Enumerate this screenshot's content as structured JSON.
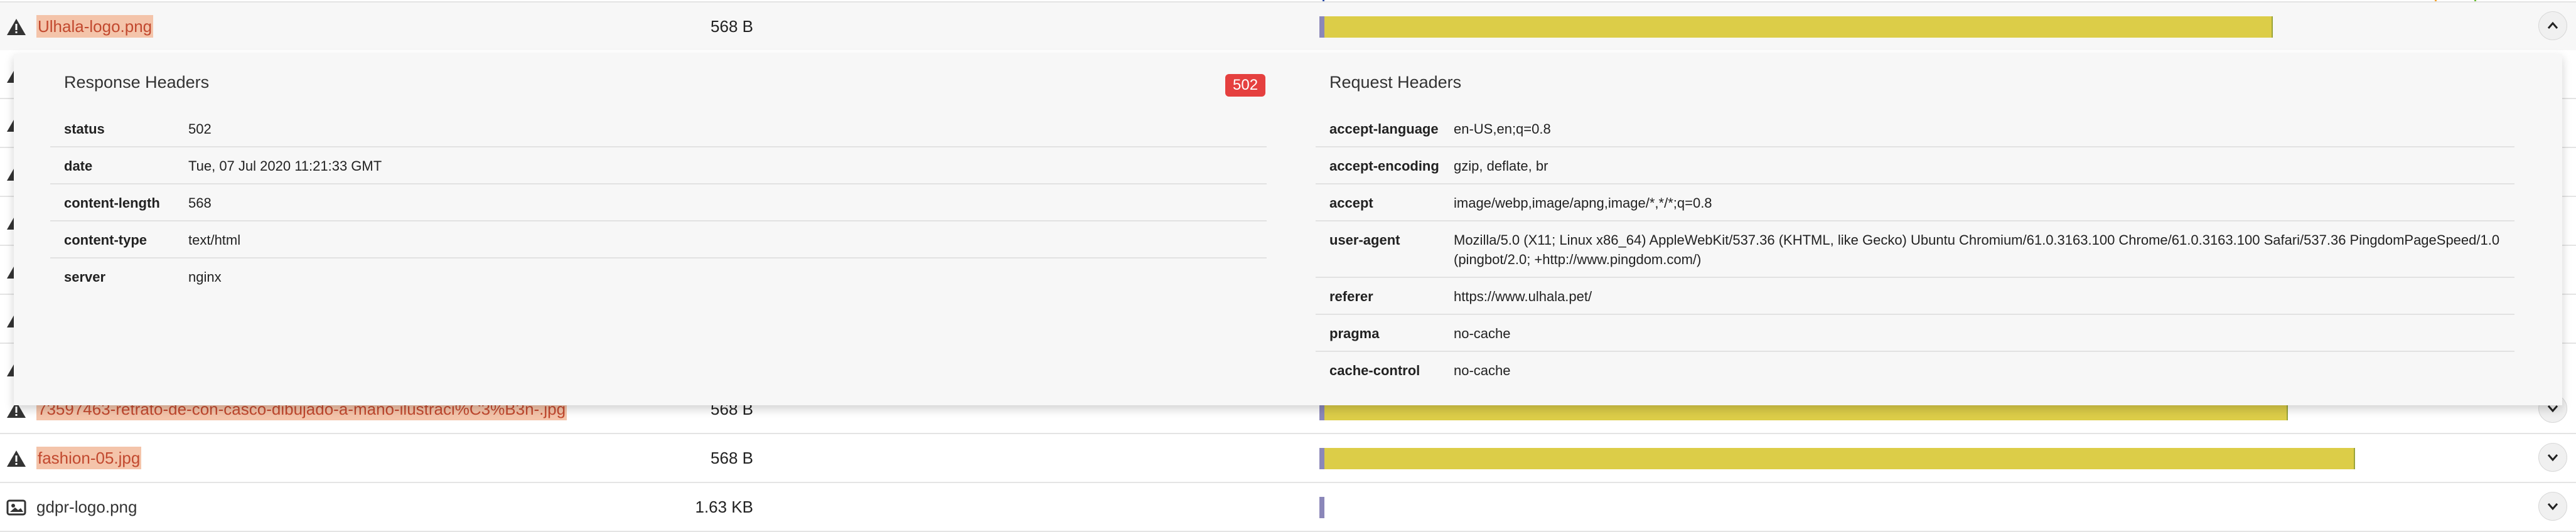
{
  "rows": [
    {
      "name": "Ulhala-logo.png",
      "size": "568 B",
      "bar_fraction": 0.822,
      "icon": "warning-icon",
      "expanded": true
    },
    {
      "name": "73597463-retrato-de-con-casco-dibujado-a-mano-ilustraci%C3%B3n-.jpg",
      "size": "568 B",
      "bar_fraction": 0.835,
      "icon": "warning-icon"
    },
    {
      "name": "fashion-05.jpg",
      "size": "568 B",
      "bar_fraction": 0.893,
      "icon": "warning-icon"
    },
    {
      "name": "gdpr-logo.png",
      "size": "1.63 KB",
      "icon": "image-icon"
    }
  ],
  "response": {
    "title": "Response Headers",
    "status_badge": "502",
    "headers": [
      {
        "key": "status",
        "value": "502"
      },
      {
        "key": "date",
        "value": "Tue, 07 Jul 2020 11:21:33 GMT"
      },
      {
        "key": "content-length",
        "value": "568"
      },
      {
        "key": "content-type",
        "value": "text/html"
      },
      {
        "key": "server",
        "value": "nginx"
      }
    ]
  },
  "request": {
    "title": "Request Headers",
    "headers": [
      {
        "key": "accept-language",
        "value": "en-US,en;q=0.8"
      },
      {
        "key": "accept-encoding",
        "value": "gzip, deflate, br"
      },
      {
        "key": "accept",
        "value": "image/webp,image/apng,image/*,*/*;q=0.8"
      },
      {
        "key": "user-agent",
        "value": "Mozilla/5.0 (X11; Linux x86_64) AppleWebKit/537.36 (KHTML, like Gecko) Ubuntu Chromium/61.0.3163.100 Chrome/61.0.3163.100 Safari/537.36 PingdomPageSpeed/1.0 (pingbot/2.0; +http://www.pingdom.com/)"
      },
      {
        "key": "referer",
        "value": "https://www.ulhala.pet/"
      },
      {
        "key": "pragma",
        "value": "no-cache"
      },
      {
        "key": "cache-control",
        "value": "no-cache"
      }
    ]
  },
  "colors": {
    "bar": "#dccd48",
    "bar_start": "#8b87b9",
    "dom_line": "#2d4fa8",
    "load_line_orange": "#f2a431",
    "load_line_green": "#6fbf3a",
    "error_badge": "#e5403f",
    "highlight": "#f4c4aa"
  }
}
